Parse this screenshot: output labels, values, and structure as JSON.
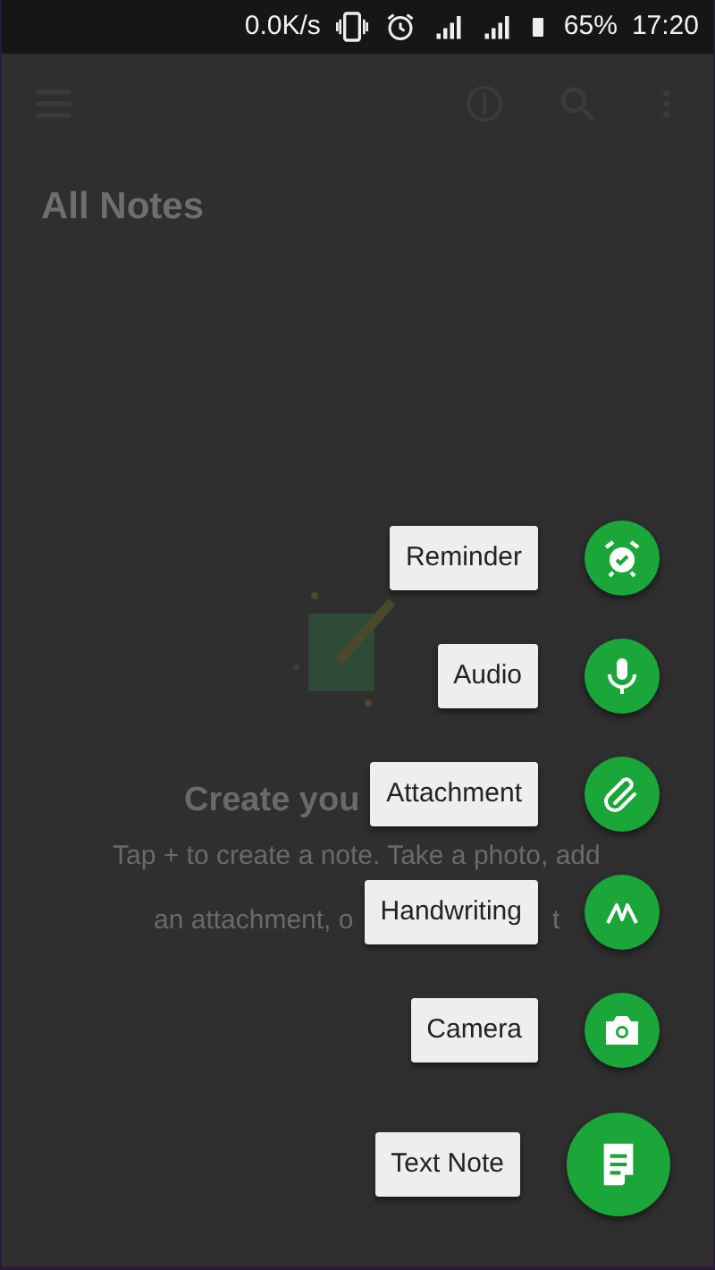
{
  "status_bar": {
    "speed": "0.0K/s",
    "battery": "65%",
    "time": "17:20"
  },
  "toolbar": {
    "title": "All Notes"
  },
  "empty_state": {
    "title": "Create you",
    "lines": [
      "Tap + to create a note. Take a photo, add",
      "an attachment, o"
    ],
    "tail": "t"
  },
  "actions": [
    {
      "label": "Reminder",
      "kind": "reminder",
      "primary": false
    },
    {
      "label": "Audio",
      "kind": "audio",
      "primary": false
    },
    {
      "label": "Attachment",
      "kind": "attachment",
      "primary": false
    },
    {
      "label": "Handwriting",
      "kind": "handwriting",
      "primary": false
    },
    {
      "label": "Camera",
      "kind": "camera",
      "primary": false
    },
    {
      "label": "Text Note",
      "kind": "note",
      "primary": true
    }
  ]
}
